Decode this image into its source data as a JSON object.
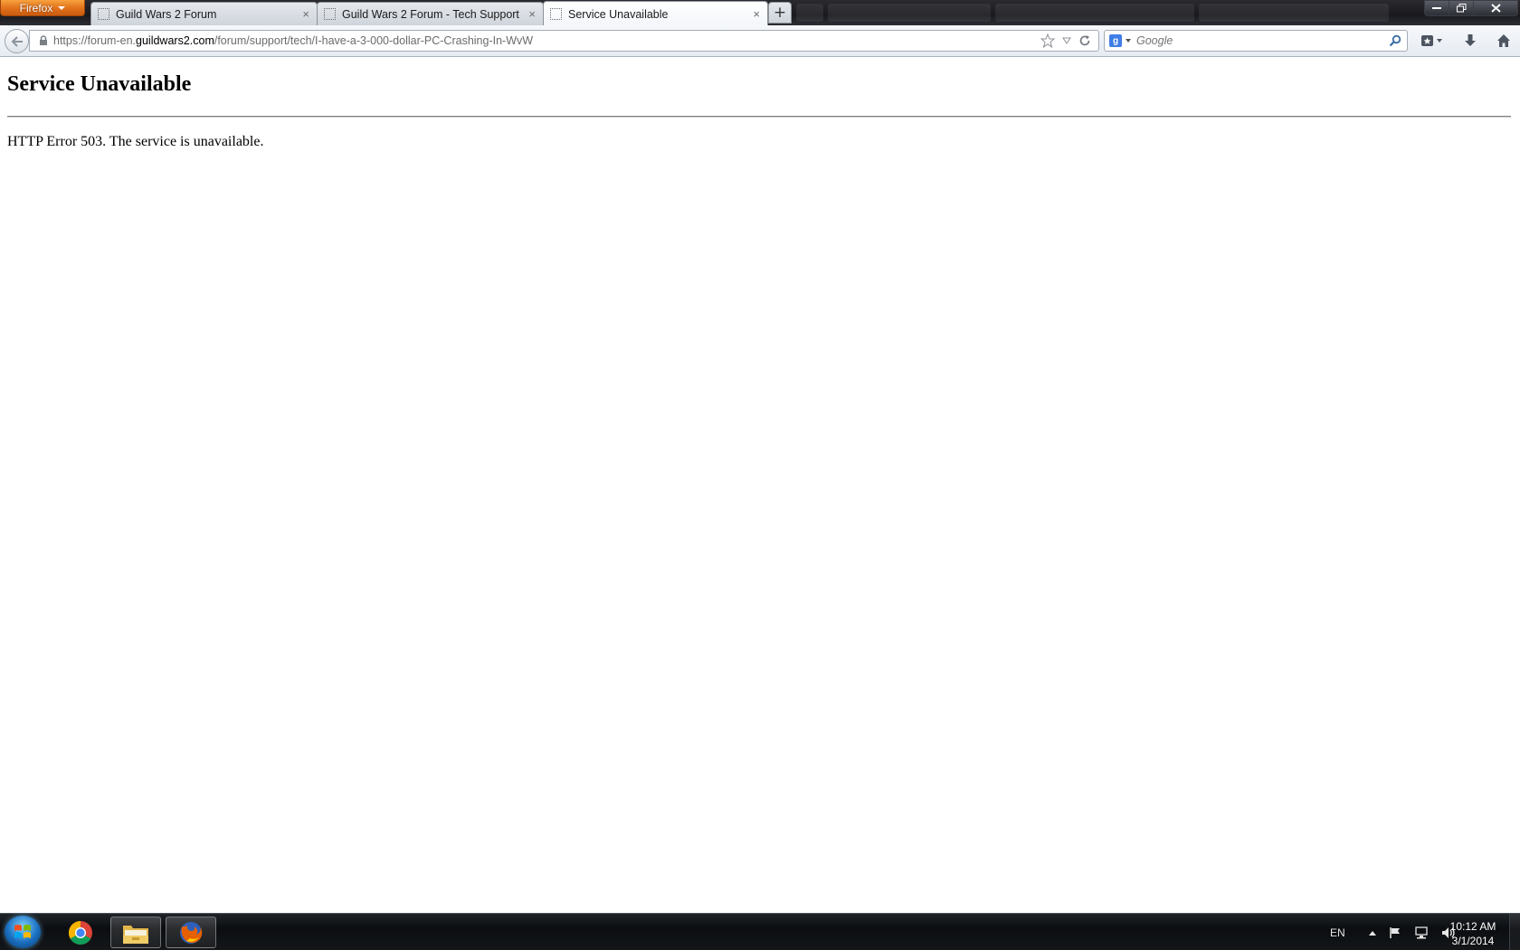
{
  "browser": {
    "menu_button_label": "Firefox",
    "tabs": [
      {
        "label": "Guild Wars 2 Forum",
        "close": "×"
      },
      {
        "label": "Guild Wars 2 Forum - Tech Support",
        "close": "×"
      },
      {
        "label": "Service Unavailable",
        "close": "×",
        "active": true
      }
    ],
    "new_tab_symbol": "+",
    "window_controls": {
      "minimize": "▬",
      "maximize": "❐",
      "close": "✕"
    },
    "url": {
      "prefix": "https://forum-en.",
      "host": "guildwars2.com",
      "path": "/forum/support/tech/I-have-a-3-000-dollar-PC-Crashing-In-WvW"
    },
    "search": {
      "placeholder": "Google",
      "engine_letter": "g"
    }
  },
  "page": {
    "heading": "Service Unavailable",
    "message": "HTTP Error 503. The service is unavailable."
  },
  "taskbar": {
    "apps": [
      {
        "name": "Chrome",
        "icon": "chrome-icon"
      },
      {
        "name": "Windows Explorer",
        "icon": "folder-icon"
      },
      {
        "name": "Firefox",
        "icon": "firefox-icon"
      }
    ],
    "tray": {
      "language": "EN",
      "clock_time": "10:12 AM",
      "clock_date": "3/1/2014"
    }
  },
  "colors": {
    "firefox_button": "#e0701a",
    "tab_active": "#ffffff",
    "taskbar": "#0b0d10"
  }
}
